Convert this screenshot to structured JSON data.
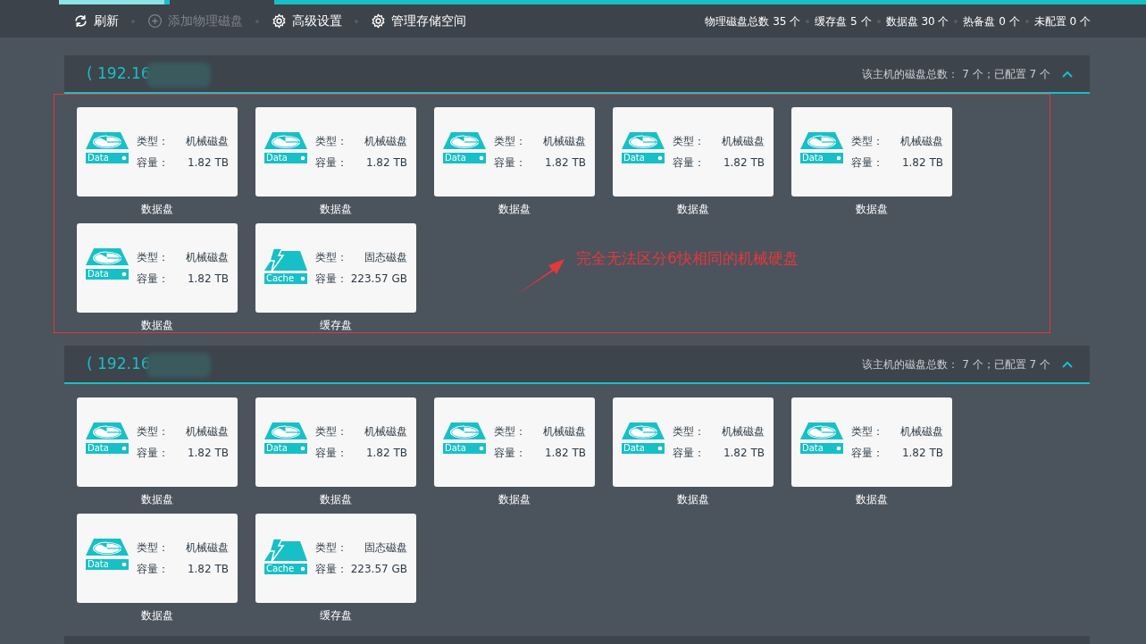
{
  "toolbar": {
    "actions": [
      {
        "label": "刷新",
        "kind": "refresh",
        "disabled": false
      },
      {
        "label": "添加物理磁盘",
        "kind": "add",
        "disabled": true
      },
      {
        "label": "高级设置",
        "kind": "settings",
        "disabled": false
      },
      {
        "label": "管理存储空间",
        "kind": "settings",
        "disabled": false
      }
    ],
    "stats": [
      "物理磁盘总数 35 个",
      "缓存盘 5 个",
      "数据盘 30 个",
      "热备盘 0 个",
      "未配置 0 个"
    ]
  },
  "hosts": [
    {
      "title": "( 192.16",
      "summary": "该主机的磁盘总数： 7 个；已配置 7 个",
      "expanded": true,
      "disks": [
        {
          "kind": "data",
          "icon_label": "Data",
          "type_label": "类型：",
          "type": "机械磁盘",
          "capacity_label": "容量：",
          "capacity": "1.82 TB",
          "role": "数据盘"
        },
        {
          "kind": "data",
          "icon_label": "Data",
          "type_label": "类型：",
          "type": "机械磁盘",
          "capacity_label": "容量：",
          "capacity": "1.82 TB",
          "role": "数据盘"
        },
        {
          "kind": "data",
          "icon_label": "Data",
          "type_label": "类型：",
          "type": "机械磁盘",
          "capacity_label": "容量：",
          "capacity": "1.82 TB",
          "role": "数据盘"
        },
        {
          "kind": "data",
          "icon_label": "Data",
          "type_label": "类型：",
          "type": "机械磁盘",
          "capacity_label": "容量：",
          "capacity": "1.82 TB",
          "role": "数据盘"
        },
        {
          "kind": "data",
          "icon_label": "Data",
          "type_label": "类型：",
          "type": "机械磁盘",
          "capacity_label": "容量：",
          "capacity": "1.82 TB",
          "role": "数据盘"
        },
        {
          "kind": "data",
          "icon_label": "Data",
          "type_label": "类型：",
          "type": "机械磁盘",
          "capacity_label": "容量：",
          "capacity": "1.82 TB",
          "role": "数据盘"
        },
        {
          "kind": "cache",
          "icon_label": "Cache",
          "type_label": "类型：",
          "type": "固态磁盘",
          "capacity_label": "容量：",
          "capacity": "223.57 GB",
          "role": "缓存盘"
        }
      ]
    },
    {
      "title": "( 192.16",
      "summary": "该主机的磁盘总数： 7 个；已配置 7 个",
      "expanded": true,
      "disks": [
        {
          "kind": "data",
          "icon_label": "Data",
          "type_label": "类型：",
          "type": "机械磁盘",
          "capacity_label": "容量：",
          "capacity": "1.82 TB",
          "role": "数据盘"
        },
        {
          "kind": "data",
          "icon_label": "Data",
          "type_label": "类型：",
          "type": "机械磁盘",
          "capacity_label": "容量：",
          "capacity": "1.82 TB",
          "role": "数据盘"
        },
        {
          "kind": "data",
          "icon_label": "Data",
          "type_label": "类型：",
          "type": "机械磁盘",
          "capacity_label": "容量：",
          "capacity": "1.82 TB",
          "role": "数据盘"
        },
        {
          "kind": "data",
          "icon_label": "Data",
          "type_label": "类型：",
          "type": "机械磁盘",
          "capacity_label": "容量：",
          "capacity": "1.82 TB",
          "role": "数据盘"
        },
        {
          "kind": "data",
          "icon_label": "Data",
          "type_label": "类型：",
          "type": "机械磁盘",
          "capacity_label": "容量：",
          "capacity": "1.82 TB",
          "role": "数据盘"
        },
        {
          "kind": "data",
          "icon_label": "Data",
          "type_label": "类型：",
          "type": "机械磁盘",
          "capacity_label": "容量：",
          "capacity": "1.82 TB",
          "role": "数据盘"
        },
        {
          "kind": "cache",
          "icon_label": "Cache",
          "type_label": "类型：",
          "type": "固态磁盘",
          "capacity_label": "容量：",
          "capacity": "223.57 GB",
          "role": "缓存盘"
        }
      ]
    }
  ],
  "annotation": {
    "text": "完全无法区分6快相同的机械硬盘"
  }
}
